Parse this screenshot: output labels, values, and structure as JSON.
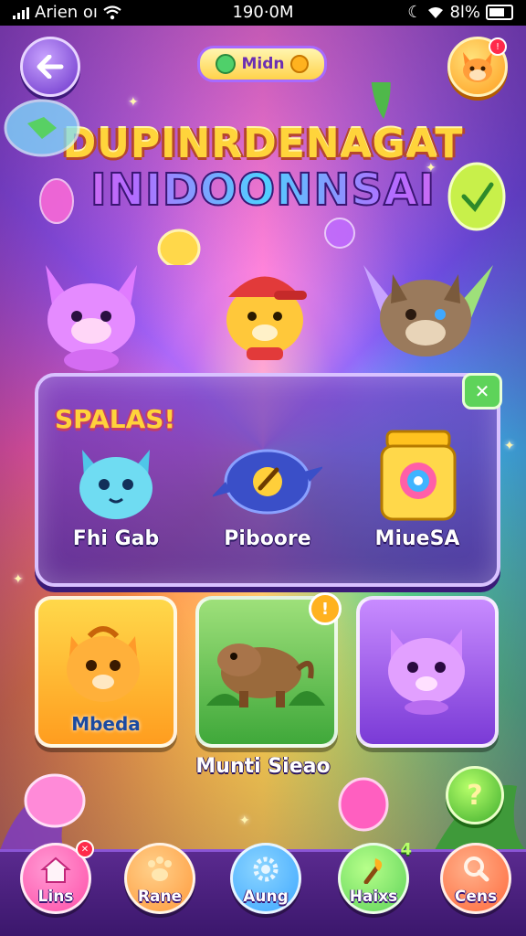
{
  "status_bar": {
    "carrier": "Arien oı",
    "time": "190·0M",
    "battery": "8l%"
  },
  "header": {
    "mode_label": "Midn",
    "profile_badge": "!"
  },
  "title": {
    "line1": "DUPINRDENAGAT",
    "line2": "INIDOONNSAI"
  },
  "featured_panel": {
    "splash_text": "SPALAS!",
    "close_label": "✕",
    "items": [
      {
        "label": "Fhi Gab",
        "icon": "blue-cat-icon"
      },
      {
        "label": "Piboore",
        "icon": "compass-ship-icon"
      },
      {
        "label": "MiueSA",
        "icon": "jar-icon"
      }
    ]
  },
  "tiles": [
    {
      "label": "Mbeda",
      "icon": "orange-hamster-icon",
      "badge": ""
    },
    {
      "label": "",
      "icon": "capybara-icon",
      "badge": "!"
    },
    {
      "label": "",
      "icon": "purple-cat-icon",
      "badge": ""
    }
  ],
  "caption": "Munti Sieao",
  "help_label": "?",
  "nav": [
    {
      "label": "Lins",
      "icon": "house-icon",
      "badge": "✕",
      "color": "#ff4fa8"
    },
    {
      "label": "Rane",
      "icon": "paw-icon",
      "badge": "",
      "color": "#ff9a3c"
    },
    {
      "label": "Aung",
      "icon": "gear-icon",
      "badge": "",
      "color": "#3fa8ff"
    },
    {
      "label": "Haixs",
      "icon": "torch-icon",
      "badge": "4",
      "color": "#5ed35a"
    },
    {
      "label": "Cens",
      "icon": "search-icon",
      "badge": "",
      "color": "#ff6a3c"
    }
  ]
}
